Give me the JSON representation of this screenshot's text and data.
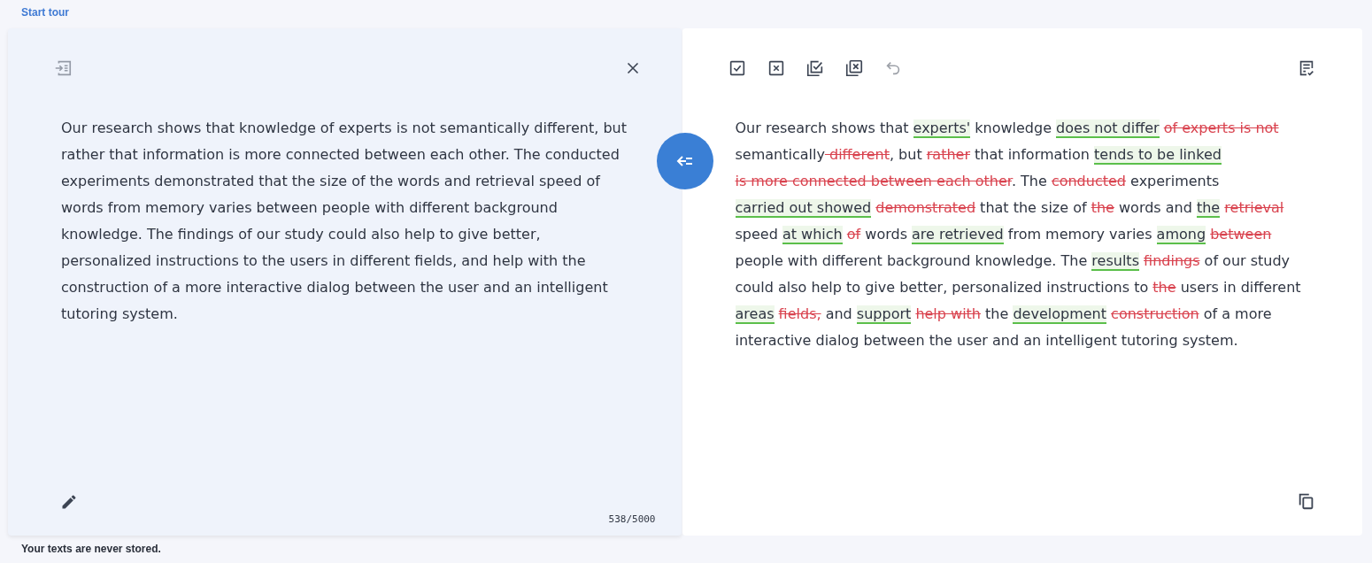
{
  "start_tour": "Start tour",
  "source": {
    "actions": [
      {
        "kind": "paste",
        "disabled": true
      },
      {
        "kind": "clear",
        "disabled": false
      }
    ],
    "text": "Our research shows that knowledge of experts is not semantically different, but rather that information is more connected between each other. The conducted experiments demonstrated that the size of the words and retrieval speed of words from memory varies between people with different background knowledge. The findings of our study could also help to give better, personalized instructions to the users in different fields, and help with the construction of a more interactive dialog between the user and an intelligent tutoring system.",
    "counter": "538/5000"
  },
  "result": {
    "actions": [
      {
        "kind": "accept",
        "disabled": false
      },
      {
        "kind": "reject",
        "disabled": false
      },
      {
        "kind": "accept-all",
        "disabled": false
      },
      {
        "kind": "reject-all",
        "disabled": false
      },
      {
        "kind": "undo",
        "disabled": true
      }
    ],
    "segments": [
      {
        "kind": "plain",
        "text": "Our research shows that "
      },
      {
        "kind": "insert",
        "text": "experts'"
      },
      {
        "kind": "plain",
        "text": " knowledge "
      },
      {
        "kind": "insert",
        "text": "does not differ"
      },
      {
        "kind": "delete",
        "text": "of experts is not",
        "space_before": true
      },
      {
        "kind": "plain",
        "text": " semantically"
      },
      {
        "kind": "delete",
        "text": " different"
      },
      {
        "kind": "plain",
        "text": ", but "
      },
      {
        "kind": "delete",
        "text": "rather"
      },
      {
        "kind": "plain",
        "text": " that information "
      },
      {
        "kind": "insert",
        "text": "tends to be linked"
      },
      {
        "kind": "delete",
        "text": "is more connected between each other",
        "space_before": true
      },
      {
        "kind": "plain",
        "text": ". The "
      },
      {
        "kind": "delete",
        "text": "conducted"
      },
      {
        "kind": "plain",
        "text": " experiments "
      },
      {
        "kind": "insert",
        "text": "carried out showed"
      },
      {
        "kind": "delete",
        "text": "demonstrated",
        "space_before": true
      },
      {
        "kind": "plain",
        "text": " that the size of "
      },
      {
        "kind": "delete",
        "text": "the"
      },
      {
        "kind": "plain",
        "text": " words and "
      },
      {
        "kind": "insert",
        "text": "the"
      },
      {
        "kind": "delete",
        "text": "retrieval",
        "space_before": true
      },
      {
        "kind": "plain",
        "text": " speed "
      },
      {
        "kind": "insert",
        "text": "at which"
      },
      {
        "kind": "delete",
        "text": "of",
        "space_before": true
      },
      {
        "kind": "plain",
        "text": " words "
      },
      {
        "kind": "insert",
        "text": "are retrieved"
      },
      {
        "kind": "plain",
        "text": " from memory varies "
      },
      {
        "kind": "insert",
        "text": "among"
      },
      {
        "kind": "delete",
        "text": "between",
        "space_before": true
      },
      {
        "kind": "plain",
        "text": " people with different background knowledge. The "
      },
      {
        "kind": "insert",
        "text": "results"
      },
      {
        "kind": "delete",
        "text": "findings",
        "space_before": true
      },
      {
        "kind": "plain",
        "text": " of our study could also help to give better, personalized instructions to "
      },
      {
        "kind": "delete",
        "text": "the"
      },
      {
        "kind": "plain",
        "text": " users in different "
      },
      {
        "kind": "insert",
        "text": "areas"
      },
      {
        "kind": "delete",
        "text": "fields,",
        "space_before": true
      },
      {
        "kind": "plain",
        "text": " and "
      },
      {
        "kind": "insert",
        "text": "support"
      },
      {
        "kind": "delete",
        "text": "help with",
        "space_before": true
      },
      {
        "kind": "plain",
        "text": " the "
      },
      {
        "kind": "insert",
        "text": "development"
      },
      {
        "kind": "delete",
        "text": "construction",
        "space_before": true
      },
      {
        "kind": "plain",
        "text": " of a more interactive dialog between the user and an intelligent tutoring system."
      }
    ]
  },
  "footer": "Your texts are never stored."
}
